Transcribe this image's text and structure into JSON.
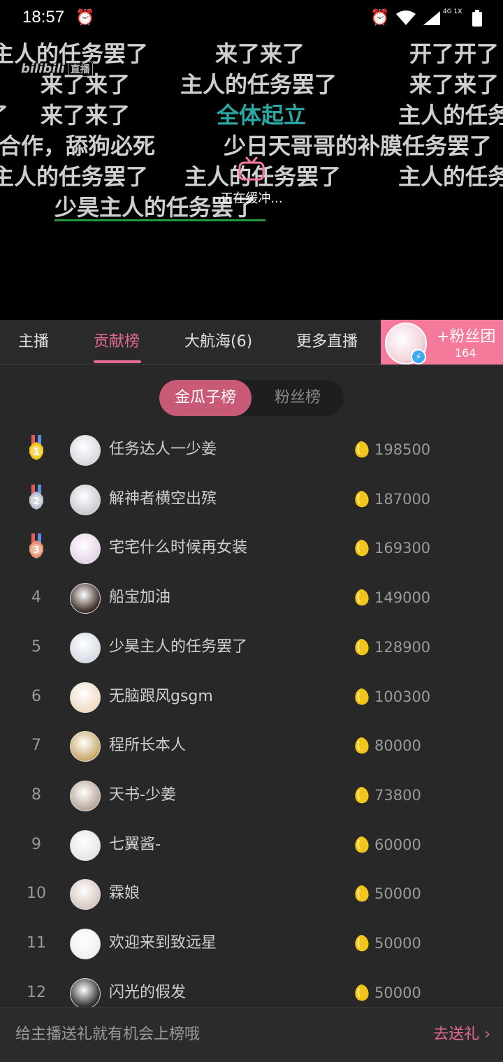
{
  "status_bar": {
    "time": "18:57",
    "network": "4G 1X"
  },
  "video": {
    "watermark": "bilibili",
    "watermark_badge": "直播",
    "buffer_text": "正在缓冲...",
    "danmaku": [
      {
        "text": "主人的任务罢了",
        "color": "#cfcfcf"
      },
      {
        "text": "来了来了",
        "color": "#cfcfcf"
      },
      {
        "text": "开了开了",
        "color": "#cfcfcf"
      },
      {
        "text": "来了来了",
        "color": "#cfcfcf"
      },
      {
        "text": "主人的任务罢了",
        "color": "#cfcfcf"
      },
      {
        "text": "来了来了",
        "color": "#cfcfcf"
      },
      {
        "text": "了",
        "color": "#cfcfcf"
      },
      {
        "text": "来了来了",
        "color": "#cfcfcf"
      },
      {
        "text": "全体起立",
        "color": "#2aa7a3"
      },
      {
        "text": "主人的任务",
        "color": "#cfcfcf"
      },
      {
        "text": "合作，舔狗必死",
        "color": "#cfcfcf"
      },
      {
        "text": "少日天哥哥的补膜任务罢了",
        "color": "#cfcfcf"
      },
      {
        "text": "主人的任务罢了",
        "color": "#cfcfcf"
      },
      {
        "text": "主人的任务罢了",
        "color": "#cfcfcf"
      },
      {
        "text": "主人的任务",
        "color": "#cfcfcf"
      },
      {
        "text": "少昊主人的任务罢了",
        "color": "#cfcfcf"
      }
    ]
  },
  "tabs": [
    {
      "label": "主播"
    },
    {
      "label": "贡献榜"
    },
    {
      "label": "大航海(6)"
    },
    {
      "label": "更多直播"
    }
  ],
  "fans_club": {
    "label": "+粉丝团",
    "count": "164"
  },
  "toggle": {
    "left": "金瓜子榜",
    "right": "粉丝榜"
  },
  "ranking": [
    {
      "rank": "1",
      "name": "任务达人一少姜",
      "score": "198500"
    },
    {
      "rank": "2",
      "name": "解神者横空出殡",
      "score": "187000"
    },
    {
      "rank": "3",
      "name": "宅宅什么时候再女装",
      "score": "169300"
    },
    {
      "rank": "4",
      "name": "船宝加油",
      "score": "149000"
    },
    {
      "rank": "5",
      "name": "少昊主人的任务罢了",
      "score": "128900"
    },
    {
      "rank": "6",
      "name": "无脑跟风gsgm",
      "score": "100300"
    },
    {
      "rank": "7",
      "name": "程所长本人",
      "score": "80000"
    },
    {
      "rank": "8",
      "name": "天书-少姜",
      "score": "73800"
    },
    {
      "rank": "9",
      "name": "七翼酱-",
      "score": "60000"
    },
    {
      "rank": "10",
      "name": "霖娘",
      "score": "50000"
    },
    {
      "rank": "11",
      "name": "欢迎来到致远星",
      "score": "50000"
    },
    {
      "rank": "12",
      "name": "闪光的假发",
      "score": "50000"
    }
  ],
  "bottom": {
    "hint": "给主播送礼就有机会上榜哦",
    "action": "去送礼 ›"
  },
  "colors": {
    "accent": "#e26a8f",
    "gold": "#f3c51a",
    "silver": "#b9c3cf",
    "bronze": "#e6936f"
  }
}
